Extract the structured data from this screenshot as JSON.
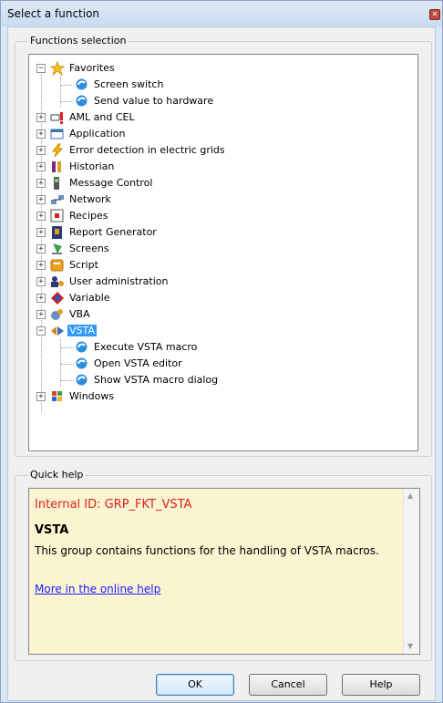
{
  "window": {
    "title": "Select a function",
    "close_icon": "close-icon"
  },
  "functions_group": {
    "label": "Functions selection",
    "tree": [
      {
        "label": "Favorites",
        "icon": "star-folder-icon",
        "expanded": true,
        "children": [
          {
            "label": "Screen switch",
            "icon": "function-icon"
          },
          {
            "label": "Send value to hardware",
            "icon": "function-icon"
          }
        ]
      },
      {
        "label": "AML and CEL",
        "icon": "alarm-icon",
        "expanded": false
      },
      {
        "label": "Application",
        "icon": "application-window-icon",
        "expanded": false
      },
      {
        "label": "Error detection in electric grids",
        "icon": "lightning-icon",
        "expanded": false
      },
      {
        "label": "Historian",
        "icon": "historian-icon",
        "expanded": false
      },
      {
        "label": "Message Control",
        "icon": "message-control-icon",
        "expanded": false
      },
      {
        "label": "Network",
        "icon": "network-icon",
        "expanded": false
      },
      {
        "label": "Recipes",
        "icon": "recipes-icon",
        "expanded": false
      },
      {
        "label": "Report Generator",
        "icon": "report-generator-icon",
        "expanded": false
      },
      {
        "label": "Screens",
        "icon": "screens-icon",
        "expanded": false
      },
      {
        "label": "Script",
        "icon": "script-icon",
        "expanded": false
      },
      {
        "label": "User administration",
        "icon": "user-admin-icon",
        "expanded": false
      },
      {
        "label": "Variable",
        "icon": "variable-icon",
        "expanded": false
      },
      {
        "label": "VBA",
        "icon": "vba-icon",
        "expanded": false
      },
      {
        "label": "VSTA",
        "icon": "vsta-icon",
        "expanded": true,
        "selected": true,
        "children": [
          {
            "label": "Execute VSTA macro",
            "icon": "function-icon"
          },
          {
            "label": "Open VSTA editor",
            "icon": "function-icon"
          },
          {
            "label": "Show VSTA macro dialog",
            "icon": "function-icon"
          }
        ]
      },
      {
        "label": "Windows",
        "icon": "windows-icon",
        "expanded": false
      }
    ]
  },
  "quick_help": {
    "label": "Quick help",
    "internal_id": "Internal ID: GRP_FKT_VSTA",
    "title": "VSTA",
    "description": "This group contains functions for the handling of VSTA macros.",
    "link": "More in the online help"
  },
  "buttons": {
    "ok": "OK",
    "cancel": "Cancel",
    "help": "Help"
  },
  "colors": {
    "selection": "#3399ff",
    "help_background": "#fbf4d1",
    "internal_id_text": "#e02020",
    "link": "#1a1aff"
  }
}
